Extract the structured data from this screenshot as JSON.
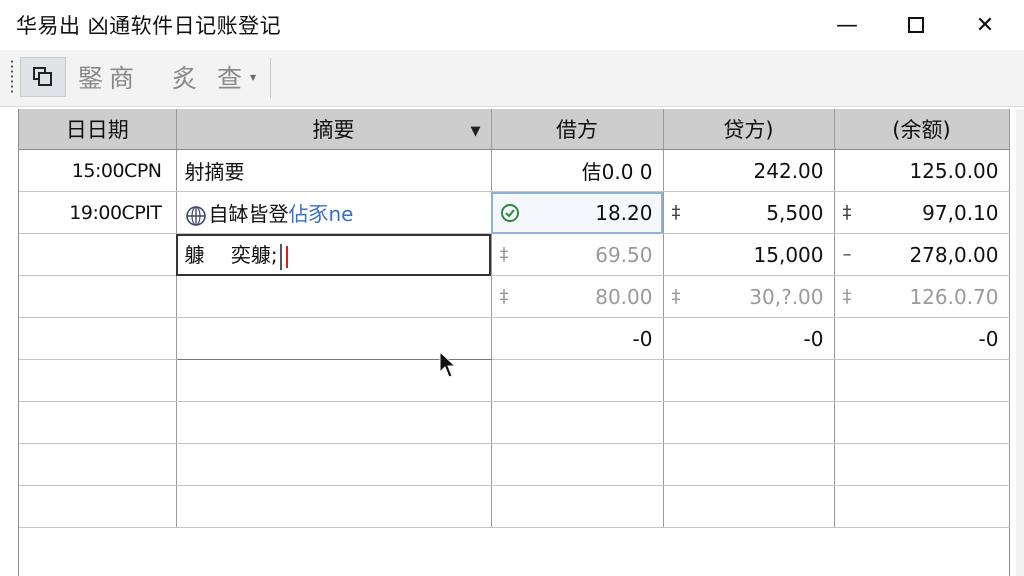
{
  "window": {
    "title": "华易出 凶通软件日记账登记",
    "minimize": "—",
    "close": "✕"
  },
  "toolbar": {
    "copy_icon": "copy-icon",
    "btn1_label": "鋻商",
    "btn2_label": "炙 查",
    "dropdown_caret": "▾"
  },
  "grid": {
    "columns": [
      "日日期",
      "摘要",
      "借方",
      "贷方)",
      "(余额)"
    ],
    "sort_indicator": "▼",
    "rows": [
      {
        "date": "15:00CPN",
        "summary": "射摘要",
        "summary_link": "",
        "debit": "佶0.0 0",
        "debit_mark": "",
        "credit": "242.00",
        "credit_mark": "",
        "balance": "125.0.00",
        "balance_mark": ""
      },
      {
        "date": "19:00CPIT",
        "summary": "自缽皆登",
        "summary_link": "佔豕ne",
        "debit": "18.20",
        "debit_mark": "",
        "credit": "5,500",
        "credit_mark": "‡",
        "balance": "97,0.10",
        "balance_mark": "‡"
      },
      {
        "date": "",
        "summary": "躿　 奕躿;",
        "summary_link": "",
        "debit": "69.50",
        "debit_mark": "‡",
        "credit": "15,000",
        "credit_mark": "",
        "balance": "278,0.00",
        "balance_mark": "–"
      },
      {
        "date": "",
        "summary": "",
        "summary_link": "",
        "debit": "80.00",
        "debit_mark": "‡",
        "credit": "30,?.00",
        "credit_mark": "‡",
        "balance": "126.0.70",
        "balance_mark": "‡"
      },
      {
        "date": "",
        "summary": "",
        "summary_link": "",
        "debit": "-0",
        "debit_mark": "",
        "credit": "-0",
        "credit_mark": "",
        "balance": "-0",
        "balance_mark": ""
      }
    ]
  },
  "colors": {
    "header_bg": "#cdcdcd",
    "link": "#3a6fc4",
    "check": "#2f8a3a",
    "caret": "#d42020"
  }
}
